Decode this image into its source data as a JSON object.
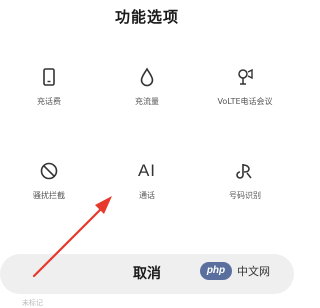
{
  "sheet": {
    "title": "功能选项",
    "options": [
      {
        "label": "充话费",
        "icon": "phone-icon"
      },
      {
        "label": "充流量",
        "icon": "droplet-icon"
      },
      {
        "label": "VoLTE电话会议",
        "icon": "conference-icon"
      },
      {
        "label": "骚扰拦截",
        "icon": "block-icon"
      },
      {
        "label": "通话",
        "icon": "ai-icon",
        "icon_text": "AI"
      },
      {
        "label": "号码识别",
        "icon": "number-id-icon"
      }
    ],
    "cancel_label": "取消",
    "bottom_hint": "未标记"
  },
  "watermark": {
    "logo_text": "php",
    "text": "中文网"
  },
  "colors": {
    "annotation_arrow": "#e53a2c",
    "cancel_bg": "#efefef"
  }
}
